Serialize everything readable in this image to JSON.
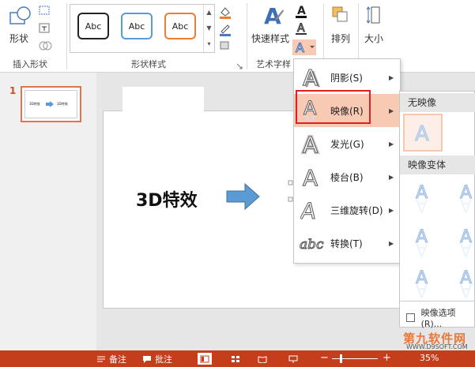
{
  "ribbon": {
    "shapes_label": "形状",
    "insert_shapes_group": "插入形状",
    "shape_styles_group": "形状样式",
    "style_cards": [
      "Abc",
      "Abc",
      "Abc"
    ],
    "quick_styles_label": "快速样式",
    "art_text_group": "艺术字样",
    "arrange_label": "排列",
    "size_label": "大小"
  },
  "menu": {
    "items": [
      {
        "label": "阴影(S)",
        "icon": "A"
      },
      {
        "label": "映像(R)",
        "icon": "A"
      },
      {
        "label": "发光(G)",
        "icon": "A"
      },
      {
        "label": "棱台(B)",
        "icon": "A"
      },
      {
        "label": "三维旋转(D)",
        "icon": "A"
      },
      {
        "label": "转换(T)",
        "icon": "abc"
      }
    ]
  },
  "submenu": {
    "no_reflection": "无映像",
    "variants": "映像变体",
    "options": "映像选项(R)..."
  },
  "slide": {
    "number": "1",
    "title": "3D特效",
    "thumb_left": "3D特效",
    "thumb_right": "3D特效"
  },
  "statusbar": {
    "notes": "备注",
    "comments": "批注",
    "zoom": "35%",
    "minus": "−",
    "plus": "+"
  },
  "watermark": {
    "line1": "第九软件网",
    "line2": "WWW.D9SOFT.COM"
  },
  "colors": {
    "accent": "#c43e1c",
    "arrow": "#5b9bd5",
    "highlight": "#f8c9b3"
  }
}
